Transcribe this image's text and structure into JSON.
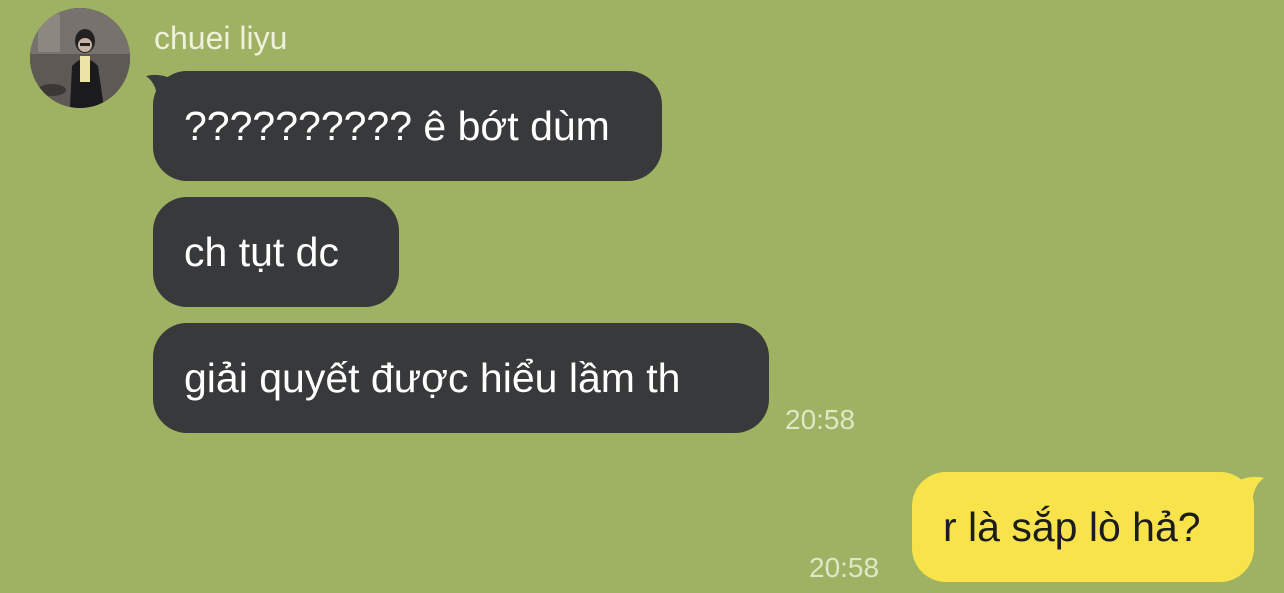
{
  "chat": {
    "sender_name": "chuei liyu",
    "incoming_messages": [
      {
        "text": "?????????? ê bớt dùm"
      },
      {
        "text": "ch tụt dc"
      },
      {
        "text": "giải quyết được hiểu lầm th"
      }
    ],
    "incoming_time": "20:58",
    "outgoing_message": {
      "text": "r là sắp lò hả?"
    },
    "outgoing_time": "20:58"
  },
  "colors": {
    "background": "#9fb263",
    "incoming_bubble": "#38393b",
    "outgoing_bubble": "#f8e34b",
    "timestamp": "#dfe7c6"
  }
}
